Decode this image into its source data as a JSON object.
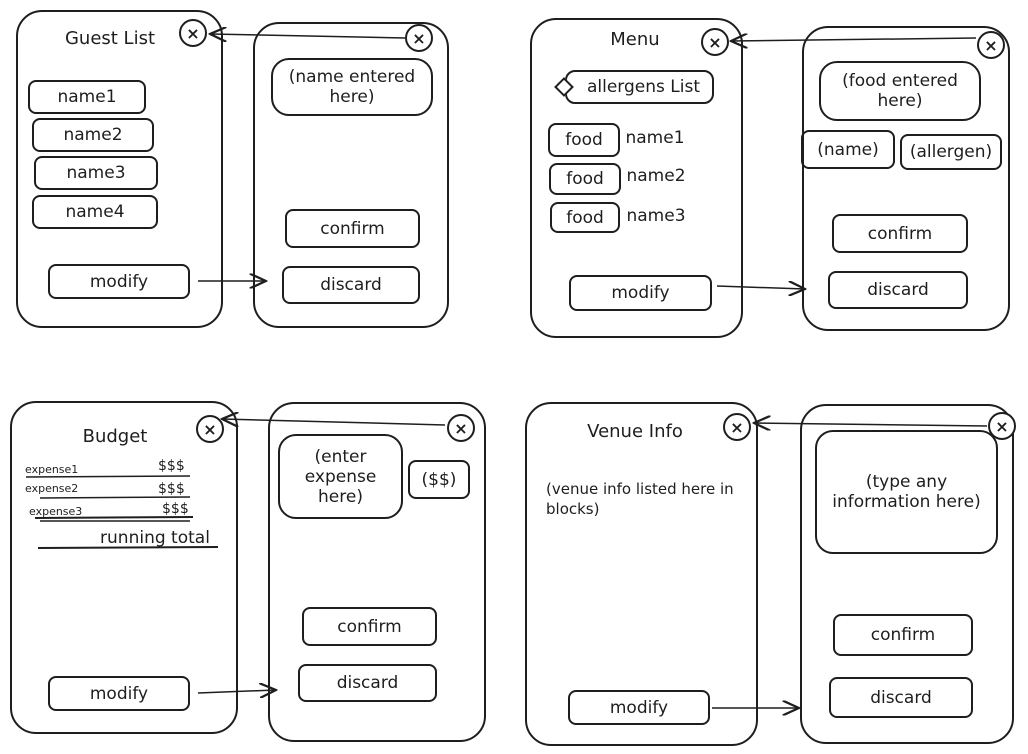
{
  "guest": {
    "title": "Guest List",
    "names": [
      "name1",
      "name2",
      "name3",
      "name4"
    ],
    "modify": "modify",
    "entry": "(name entered here)",
    "confirm": "confirm",
    "discard": "discard",
    "close": "×"
  },
  "menu": {
    "title": "Menu",
    "allergens": "allergens List",
    "food_label": "food",
    "names": [
      "name1",
      "name2",
      "name3"
    ],
    "modify": "modify",
    "entry": "(food entered here)",
    "name_field": "(name)",
    "allergen_field": "(allergen)",
    "confirm": "confirm",
    "discard": "discard",
    "close": "×"
  },
  "budget": {
    "title": "Budget",
    "expenses": [
      {
        "label": "expense1",
        "amount": "$$$"
      },
      {
        "label": "expense2",
        "amount": "$$$"
      },
      {
        "label": "expense3",
        "amount": "$$$"
      }
    ],
    "running_total": "running total",
    "modify": "modify",
    "entry": "(enter expense here)",
    "amount_field": "($$)",
    "confirm": "confirm",
    "discard": "discard",
    "close": "×"
  },
  "venue": {
    "title": "Venue Info",
    "body": "(venue info listed here in blocks)",
    "modify": "modify",
    "entry": "(type any information here)",
    "confirm": "confirm",
    "discard": "discard",
    "close": "×"
  }
}
